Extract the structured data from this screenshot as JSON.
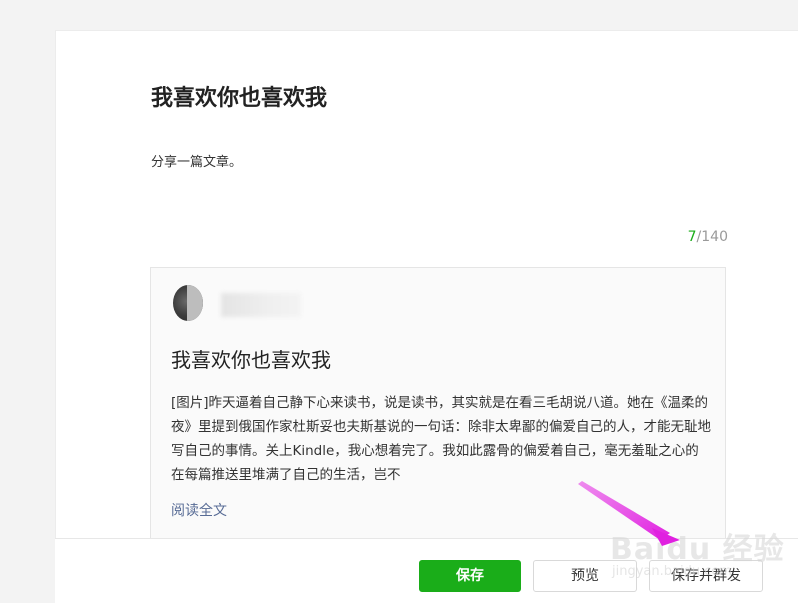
{
  "editor": {
    "title": "我喜欢你也喜欢我",
    "description": "分享一篇文章。",
    "char_count": {
      "current": "7",
      "max": "/140"
    }
  },
  "shared_card": {
    "title": "我喜欢你也喜欢我",
    "excerpt": "[图片]昨天逼着自己静下心来读书，说是读书，其实就是在看三毛胡说八道。她在《温柔的夜》里提到俄国作家杜斯妥也夫斯基说的一句话：除非太卑鄙的偏爱自己的人，才能无耻地写自己的事情。关上Kindle，我心想着完了。我如此露骨的偏爱着自己，毫无羞耻之心的在每篇推送里堆满了自己的生活，岂不",
    "read_more": "阅读全文"
  },
  "footer": {
    "save_label": "保存",
    "preview_label": "预览",
    "save_publish_label": "保存并群发"
  },
  "watermark": {
    "brand": "Baidu 经验",
    "url": "jingyan.baidu.com"
  },
  "colors": {
    "accent": "#1aad19",
    "link": "#576b95",
    "annotation_arrow": "#e642e6"
  }
}
